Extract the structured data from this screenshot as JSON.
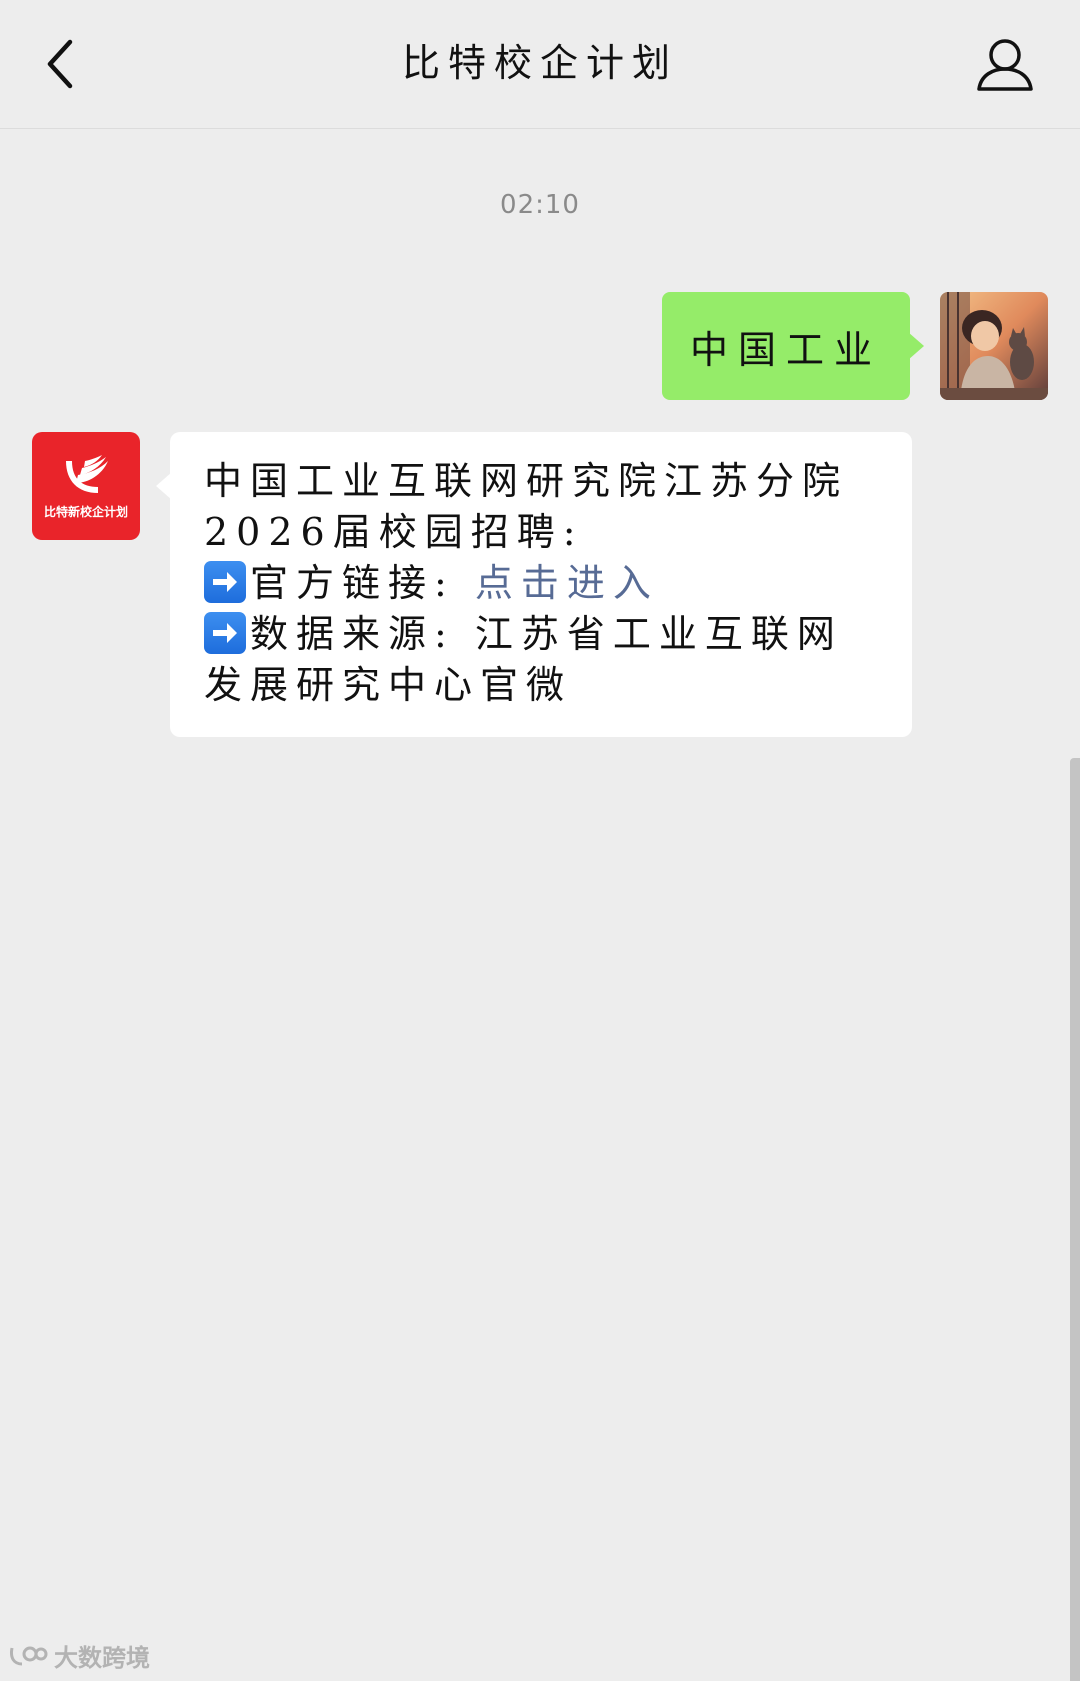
{
  "header": {
    "title": "比特校企计划",
    "back_icon": "chevron-left-icon",
    "profile_icon": "person-icon"
  },
  "chat": {
    "timestamp": "02:10",
    "outgoing": {
      "text": "中国工业",
      "bubble_color": "#95ec69"
    },
    "incoming": {
      "sender_logo_text": "比特新校企计划",
      "sender_logo_color": "#e9242a",
      "line1": "中国工业互联网研究院江苏分院2026届校园招聘:",
      "link_label": "官方链接:",
      "link_text": "点击进入",
      "source_label": "数据来源:",
      "source_text": "江苏省工业互联网发展研究中心官微",
      "link_color": "#576b95"
    }
  },
  "watermark": {
    "text": "大数跨境"
  }
}
